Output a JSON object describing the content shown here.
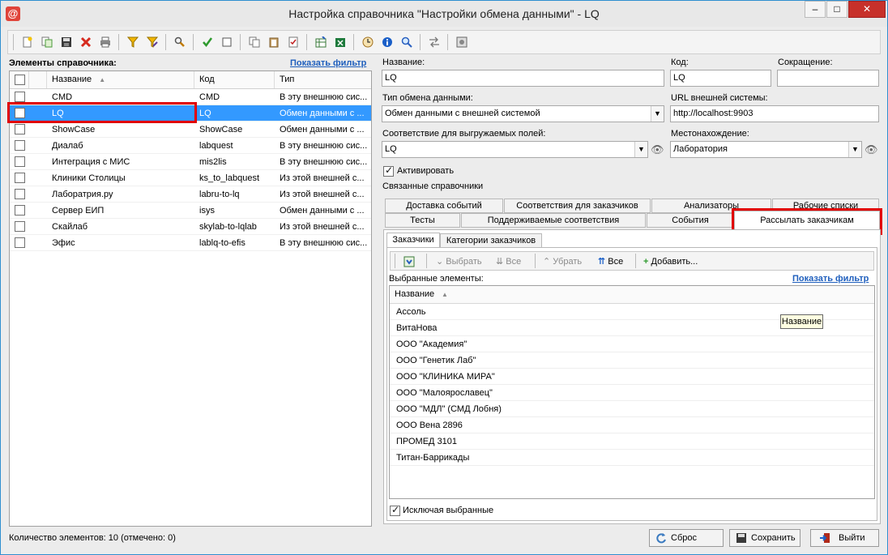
{
  "window": {
    "title": "Настройка справочника \"Настройки обмена данными\" - LQ",
    "app_icon_text": "@",
    "minimize": "–",
    "maximize": "□",
    "close": "✕"
  },
  "left": {
    "label": "Элементы справочника:",
    "filter_link": "Показать фильтр",
    "columns": [
      "Название",
      "Код",
      "Тип"
    ],
    "sort_glyph": "▲",
    "rows": [
      {
        "name": "CMD",
        "code": "CMD",
        "type": "В эту внешнюю сис..."
      },
      {
        "name": "LQ",
        "code": "LQ",
        "type": "Обмен данными с ..."
      },
      {
        "name": "ShowCase",
        "code": "ShowCase",
        "type": "Обмен данными с ..."
      },
      {
        "name": "Диалаб",
        "code": "labquest",
        "type": "В эту внешнюю сис..."
      },
      {
        "name": "Интеграция с МИС",
        "code": "mis2lis",
        "type": "В эту внешнюю сис..."
      },
      {
        "name": "Клиники Столицы",
        "code": "ks_to_labquest",
        "type": "Из этой внешней с..."
      },
      {
        "name": "Лаборатрия.ру",
        "code": "labru-to-lq",
        "type": "Из этой внешней с..."
      },
      {
        "name": "Сервер ЕИП",
        "code": "isys",
        "type": "Обмен данными с ..."
      },
      {
        "name": "Скайлаб",
        "code": "skylab-to-lqlab",
        "type": "Из этой внешней с..."
      },
      {
        "name": "Эфис",
        "code": "lablq-to-efis",
        "type": "В эту внешнюю сис..."
      }
    ],
    "count_text": "Количество элементов: 10 (отмечено: 0)"
  },
  "form": {
    "name_label": "Название:",
    "name_value": "LQ",
    "code_label": "Код:",
    "code_value": "LQ",
    "short_label": "Сокращение:",
    "short_value": "",
    "exchange_type_label": "Тип обмена данными:",
    "exchange_type_value": "Обмен данными с внешней системой",
    "url_label": "URL внешней системы:",
    "url_value": "http://localhost:9903",
    "mapping_label": "Соответствие для выгружаемых полей:",
    "mapping_value": "LQ",
    "location_label": "Местонахождение:",
    "location_value": "Лаборатория",
    "activate_label": "Активировать",
    "related_label": "Связанные справочники"
  },
  "tabs_row1": [
    "Доставка событий",
    "Соответствия для заказчиков",
    "Анализаторы",
    "Рабочие списки"
  ],
  "tabs_row2": [
    "Тесты",
    "Поддерживаемые соответствия",
    "События",
    "Рассылать заказчикам"
  ],
  "inner_tabs": [
    "Заказчики",
    "Категории заказчиков"
  ],
  "sub_toolbar": {
    "select": "Выбрать",
    "all1": "Все",
    "remove": "Убрать",
    "all2": "Все",
    "add": "Добавить..."
  },
  "selected": {
    "label": "Выбранные элементы:",
    "filter_link": "Показать фильтр",
    "column": "Название",
    "items": [
      "Ассоль",
      "ВитаНова",
      "ООО \"Академия\"",
      "ООО \"Генетик Лаб\"",
      "ООО \"КЛИНИКА МИРА\"",
      "ООО \"Малоярославец\"",
      "ООО \"МДЛ\" (СМД Лобня)",
      "ООО Вена 2896",
      "ПРОМЕД 3101",
      "Титан-Баррикады"
    ],
    "tooltip": "Название",
    "exclude_label": "Исключая выбранные"
  },
  "buttons": {
    "reset": "Сброс",
    "save": "Сохранить",
    "exit": "Выйти"
  },
  "colors": {
    "selection": "#3399ff",
    "link": "#1f5fbd",
    "highlight_box": "#e10000",
    "close_button": "#c7302a"
  }
}
